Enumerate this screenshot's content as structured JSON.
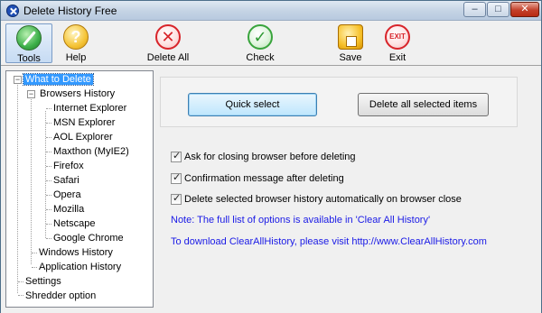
{
  "window": {
    "title": "Delete History Free"
  },
  "title_buttons": {
    "minimize": "–",
    "maximize": "□",
    "close": "✕"
  },
  "toolbar": {
    "tools": "Tools",
    "help": "Help",
    "delete_all": "Delete All",
    "check": "Check",
    "save": "Save",
    "exit": "Exit",
    "help_glyph": "?",
    "delete_glyph": "✕",
    "check_glyph": "✓",
    "exit_glyph": "EXIT"
  },
  "tree": {
    "expander_glyph": "−",
    "items": [
      "What to Delete",
      "Browsers History",
      "Internet Explorer",
      "MSN Explorer",
      "AOL Explorer",
      "Maxthon (MyIE2)",
      "Firefox",
      "Safari",
      "Opera",
      "Mozilla",
      "Netscape",
      "Google Chrome",
      "Windows History",
      "Application History",
      "Settings",
      "Shredder option"
    ]
  },
  "buttons": {
    "quick_select": "Quick select",
    "delete_selected": "Delete all selected items"
  },
  "options": [
    {
      "label": "Ask for closing browser before deleting",
      "checked": true
    },
    {
      "label": "Confirmation message after deleting",
      "checked": true
    },
    {
      "label": "Delete selected browser history automatically on browser close",
      "checked": true
    }
  ],
  "notes": {
    "line1": "Note: The full list of options is available in 'Clear All History'",
    "line2": "To download ClearAllHistory, please visit http://www.ClearAllHistory.com"
  },
  "colors": {
    "selection": "#3399ff",
    "note_text": "#1a1ae6"
  }
}
